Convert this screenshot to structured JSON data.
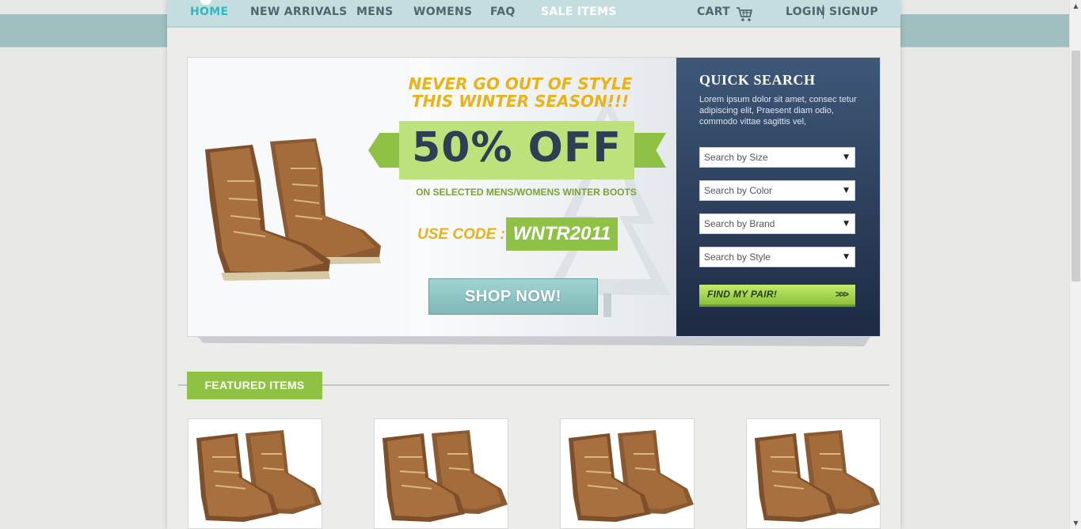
{
  "nav": {
    "items": [
      {
        "label": "HOME",
        "active": true
      },
      {
        "label": "NEW ARRIVALS"
      },
      {
        "label": "MENS"
      },
      {
        "label": "WOMENS"
      },
      {
        "label": "FAQ"
      },
      {
        "label": "SALE ITEMS"
      }
    ],
    "cart_label": "CART",
    "login_label": "LOGIN",
    "signup_label": "SIGNUP"
  },
  "hero": {
    "headline_line1": "NEVER GO OUT OF STYLE",
    "headline_line2": "THIS WINTER SEASON!!!",
    "offer": "50% OFF",
    "offer_sub": "ON SELECTED MENS/WOMENS WINTER BOOTS",
    "use_code_label": "USE CODE :",
    "code": "WNTR2011",
    "shop_button": "SHOP NOW!"
  },
  "quick_search": {
    "title": "QUICK SEARCH",
    "description": "Lorem ipsum dolor sit amet, consec tetur adipiscing elit, Praesent diam odio, commodo vittae sagittis vel,",
    "selects": [
      {
        "label": "Search by Size"
      },
      {
        "label": "Search by Color"
      },
      {
        "label": "Search by Brand"
      },
      {
        "label": "Search by Style"
      }
    ],
    "find_button": "FIND MY PAIR!"
  },
  "featured": {
    "title": "FEATURED ITEMS"
  },
  "colors": {
    "accent_green": "#8fc145",
    "nav_bg": "#c4dedf",
    "active_nav": "#33b6c2",
    "headline_yellow": "#e8b21a",
    "quick_search_bg": "#2d3f5c"
  }
}
